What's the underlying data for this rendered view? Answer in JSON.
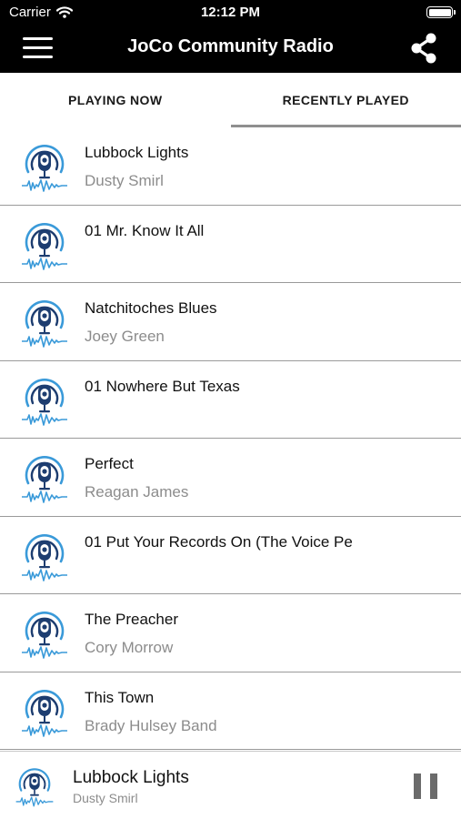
{
  "status_bar": {
    "carrier": "Carrier",
    "time": "12:12 PM",
    "icons": [
      "wifi-icon",
      "battery-icon"
    ]
  },
  "nav": {
    "title": "JoCo Community Radio",
    "left_icon": "menu-icon",
    "right_icon": "share-icon"
  },
  "tabs": [
    {
      "label": "PLAYING NOW",
      "active": false
    },
    {
      "label": "RECENTLY PLAYED",
      "active": true
    }
  ],
  "tracks": [
    {
      "title": "Lubbock Lights",
      "artist": "Dusty Smirl"
    },
    {
      "title": "01 Mr. Know It All",
      "artist": ""
    },
    {
      "title": "Natchitoches Blues",
      "artist": "Joey Green"
    },
    {
      "title": "01 Nowhere But Texas",
      "artist": ""
    },
    {
      "title": "Perfect",
      "artist": "Reagan James"
    },
    {
      "title": "01 Put Your Records On (The Voice Pe",
      "artist": ""
    },
    {
      "title": "The Preacher",
      "artist": "Cory Morrow"
    },
    {
      "title": "This Town",
      "artist": "Brady Hulsey Band"
    }
  ],
  "now_playing": {
    "title": "Lubbock Lights",
    "artist": "Dusty Smirl",
    "state_icon": "pause-icon"
  },
  "colors": {
    "header_bg": "#000000",
    "logo_dark": "#1d3d70",
    "logo_light": "#3a9ad9",
    "divider": "#9a9a9a",
    "secondary_text": "#8c8c8c"
  }
}
